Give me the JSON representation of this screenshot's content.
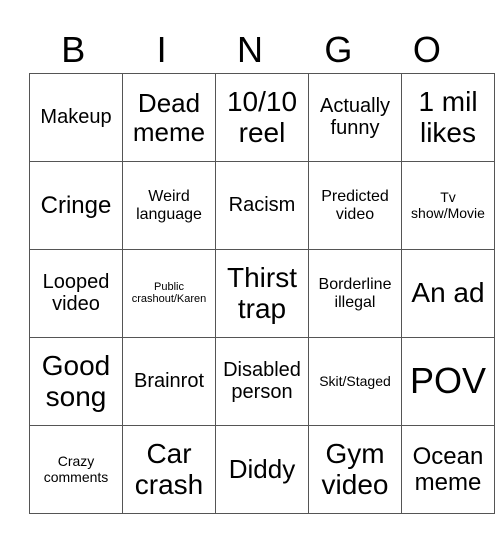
{
  "header": [
    "B",
    "I",
    "N",
    "G",
    "O"
  ],
  "cells": [
    [
      "Makeup",
      "Dead meme",
      "10/10 reel",
      "Actually funny",
      "1 mil likes"
    ],
    [
      "Cringe",
      "Weird language",
      "Racism",
      "Predicted video",
      "Tv show/Movie"
    ],
    [
      "Looped video",
      "Public crashout/Karen",
      "Thirst trap",
      "Borderline illegal",
      "An ad"
    ],
    [
      "Good song",
      "Brainrot",
      "Disabled person",
      "Skit/Staged",
      "POV"
    ],
    [
      "Crazy comments",
      "Car crash",
      "Diddy",
      "Gym video",
      "Ocean meme"
    ]
  ]
}
